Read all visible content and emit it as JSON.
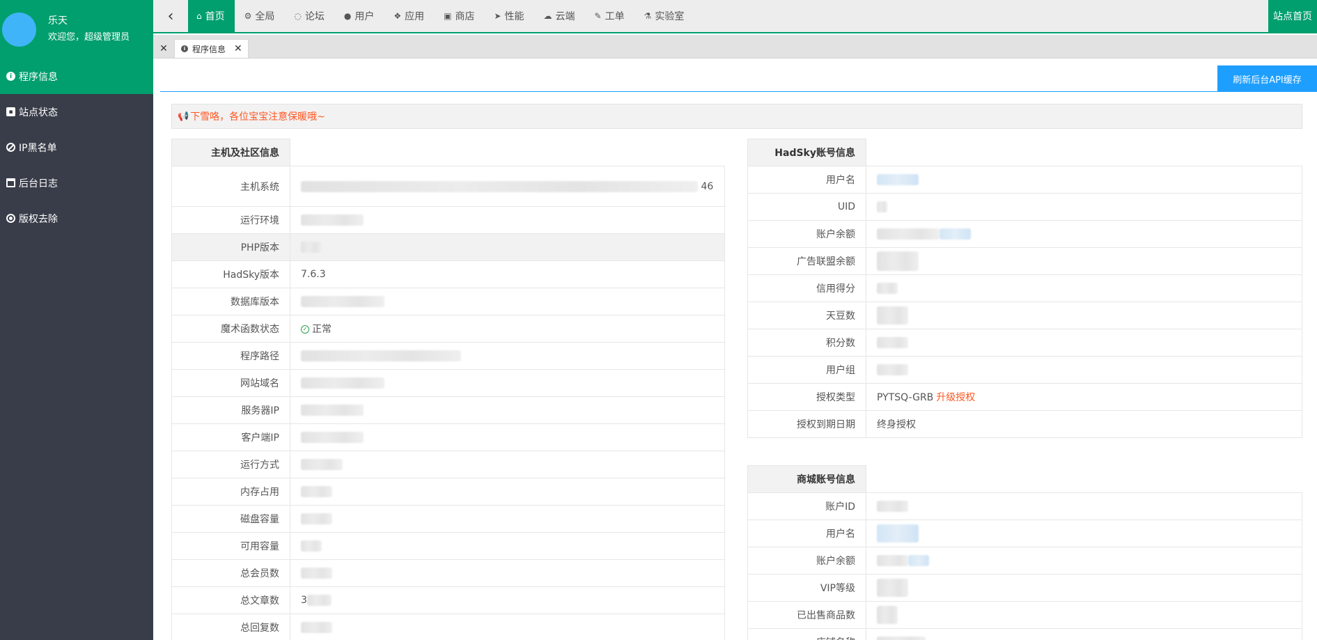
{
  "profile": {
    "name": "乐天",
    "greeting": "欢迎您，超级管理员"
  },
  "sidebar": {
    "items": [
      {
        "label": "程序信息",
        "icon": "info-circle-icon"
      },
      {
        "label": "站点状态",
        "icon": "lock-icon"
      },
      {
        "label": "IP黑名单",
        "icon": "ban-icon"
      },
      {
        "label": "后台日志",
        "icon": "calendar-icon"
      },
      {
        "label": "版权去除",
        "icon": "dot-circle-icon"
      }
    ]
  },
  "topnav": {
    "collapse_icon": "‹",
    "items": [
      {
        "label": "首页",
        "icon": "home-icon"
      },
      {
        "label": "全局",
        "icon": "cogs-icon"
      },
      {
        "label": "论坛",
        "icon": "comment-icon"
      },
      {
        "label": "用户",
        "icon": "users-icon"
      },
      {
        "label": "应用",
        "icon": "cubes-icon"
      },
      {
        "label": "商店",
        "icon": "shopping-bag-icon"
      },
      {
        "label": "性能",
        "icon": "send-icon"
      },
      {
        "label": "云端",
        "icon": "cloud-icon"
      },
      {
        "label": "工单",
        "icon": "wrench-icon"
      },
      {
        "label": "实验室",
        "icon": "flask-icon"
      }
    ],
    "home_button": "站点首页"
  },
  "tabs": {
    "active_tab": "程序信息"
  },
  "toolbar": {
    "refresh_button": "刷新后台API缓存"
  },
  "notice": {
    "text": "下雪咯，各位宝宝注意保暖哦~"
  },
  "host_table": {
    "header": "主机及社区信息",
    "rows": [
      {
        "label": "主机系统",
        "value": "46"
      },
      {
        "label": "运行环境",
        "value": ""
      },
      {
        "label": "PHP版本",
        "value": ""
      },
      {
        "label": "HadSky版本",
        "value": "7.6.3"
      },
      {
        "label": "数据库版本",
        "value": ""
      },
      {
        "label": "魔术函数状态",
        "value": "正常"
      },
      {
        "label": "程序路径",
        "value": ""
      },
      {
        "label": "网站域名",
        "value": ""
      },
      {
        "label": "服务器IP",
        "value": ""
      },
      {
        "label": "客户端IP",
        "value": ""
      },
      {
        "label": "运行方式",
        "value": ""
      },
      {
        "label": "内存占用",
        "value": ""
      },
      {
        "label": "磁盘容量",
        "value": ""
      },
      {
        "label": "可用容量",
        "value": ""
      },
      {
        "label": "总会员数",
        "value": ""
      },
      {
        "label": "总文章数",
        "value": "3"
      },
      {
        "label": "总回复数",
        "value": ""
      }
    ]
  },
  "account_table": {
    "header": "HadSky账号信息",
    "rows": [
      {
        "label": "用户名",
        "value": ""
      },
      {
        "label": "UID",
        "value": ""
      },
      {
        "label": "账户余额",
        "value": ""
      },
      {
        "label": "广告联盟余额",
        "value": ""
      },
      {
        "label": "信用得分",
        "value": ""
      },
      {
        "label": "天豆数",
        "value": ""
      },
      {
        "label": "积分数",
        "value": ""
      },
      {
        "label": "用户组",
        "value": ""
      },
      {
        "label": "授权类型",
        "value": "PYTSQ-GRB",
        "link": "升级授权"
      },
      {
        "label": "授权到期日期",
        "value": "终身授权"
      }
    ]
  },
  "shop_table": {
    "header": "商城账号信息",
    "rows": [
      {
        "label": "账户ID",
        "value": ""
      },
      {
        "label": "用户名",
        "value": ""
      },
      {
        "label": "账户余额",
        "value": ""
      },
      {
        "label": "VIP等级",
        "value": ""
      },
      {
        "label": "已出售商品数",
        "value": ""
      },
      {
        "label": "店铺名称",
        "value": ""
      }
    ]
  },
  "colors": {
    "brand_green": "#009f6d",
    "sidebar_bg": "#393d49",
    "accent_blue": "#1e9fff",
    "notice_text": "#ff5722"
  }
}
